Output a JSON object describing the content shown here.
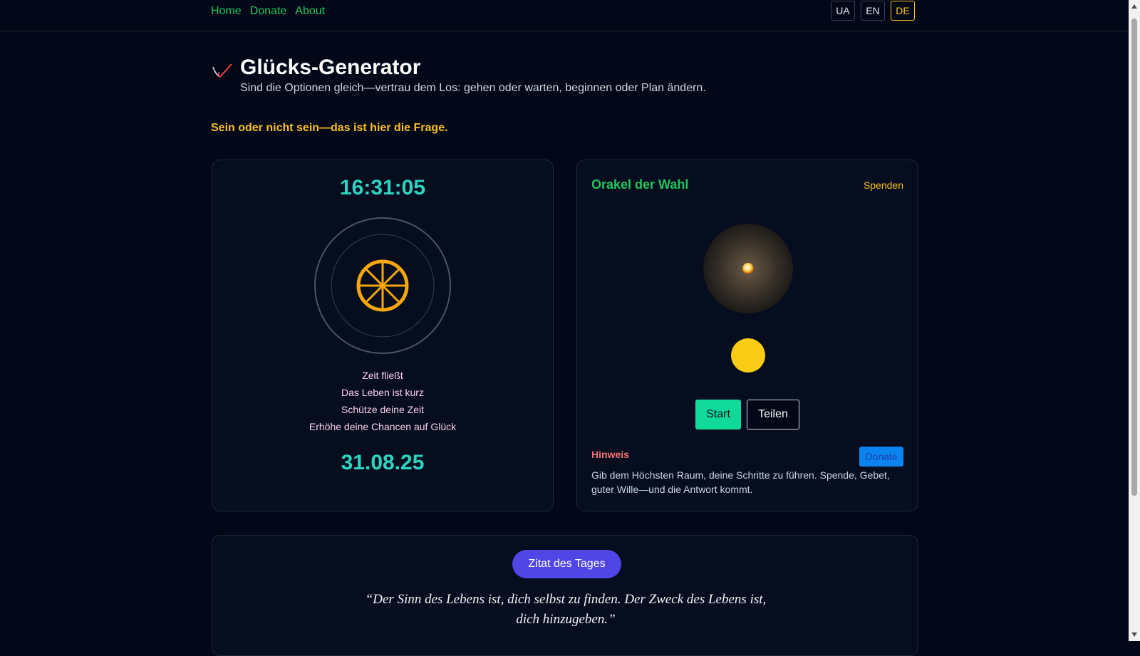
{
  "nav": {
    "links": [
      {
        "label": "Home"
      },
      {
        "label": "Donate"
      },
      {
        "label": "About"
      }
    ],
    "languages": [
      {
        "label": "UA"
      },
      {
        "label": "EN"
      },
      {
        "label": "DE",
        "active": true
      }
    ]
  },
  "header": {
    "title": "Glücks-Generator",
    "subtitle": "Sind die Optionen gleich—vertrau dem Los: gehen oder warten, beginnen oder Plan ändern.",
    "tagline": "Sein oder nicht sein—das ist hier die Frage."
  },
  "clock": {
    "time": "16:31:05",
    "mantras": [
      "Zeit fließt",
      "Das Leben ist kurz",
      "Schütze deine Zeit",
      "Erhöhe deine Chancen auf Glück"
    ],
    "date": "31.08.25"
  },
  "oracle": {
    "title": "Orakel der Wahl",
    "donate_link": "Spenden",
    "start_label": "Start",
    "share_label": "Teilen",
    "hint_label": "Hinweis",
    "donate_button": "Donate",
    "hint_text": "Gib dem Höchsten Raum, deine Schritte zu führen. Spende, Gebet, guter Wille—und die Antwort kommt."
  },
  "quote": {
    "badge": "Zitat des Tages",
    "text": "“Der Sinn des Lebens ist, dich selbst zu finden. Der Zweck des Lebens ist, dich hinzugeben.”"
  },
  "colors": {
    "background": "#020817",
    "accent_green": "#22c55e",
    "accent_teal": "#2dd4bf",
    "accent_gold": "#fbbf24",
    "accent_indigo": "#4f46e5",
    "hint_red": "#f87171"
  },
  "icons": {
    "logo": "heart-check-icon",
    "wheel": "wheel-of-fortune-icon",
    "orb": "glowing-orb-icon",
    "sun": "sun-icon"
  }
}
